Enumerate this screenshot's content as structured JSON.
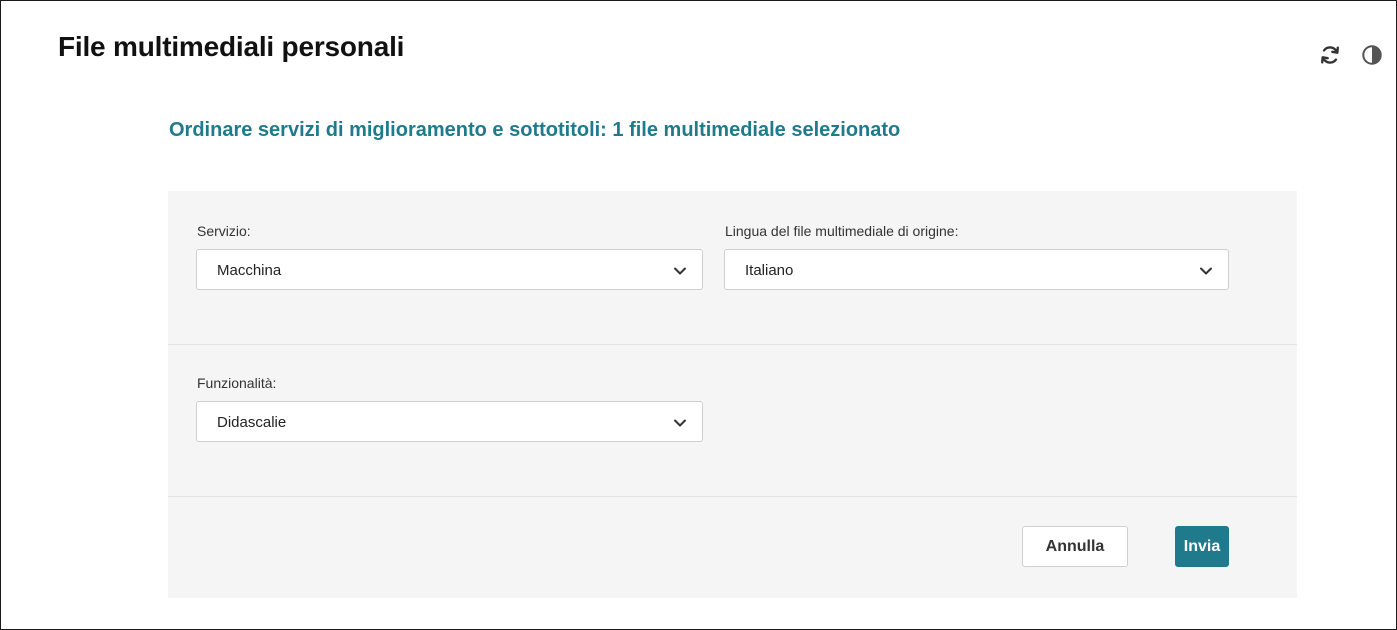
{
  "header": {
    "title": "File multimediali personali",
    "icons": [
      "refresh-icon",
      "contrast-icon"
    ]
  },
  "subtitle": "Ordinare servizi di miglioramento e sottotitoli: 1 file multimediale selezionato",
  "form": {
    "service": {
      "label": "Servizio:",
      "value": "Macchina"
    },
    "source_language": {
      "label": "Lingua del file multimediale di origine:",
      "value": "Italiano"
    },
    "feature": {
      "label": "Funzionalità:",
      "value": "Didascalie"
    }
  },
  "actions": {
    "cancel_label": "Annulla",
    "submit_label": "Invia"
  },
  "colors": {
    "accent": "#1f7a8c",
    "panel_bg": "#f5f5f5"
  }
}
